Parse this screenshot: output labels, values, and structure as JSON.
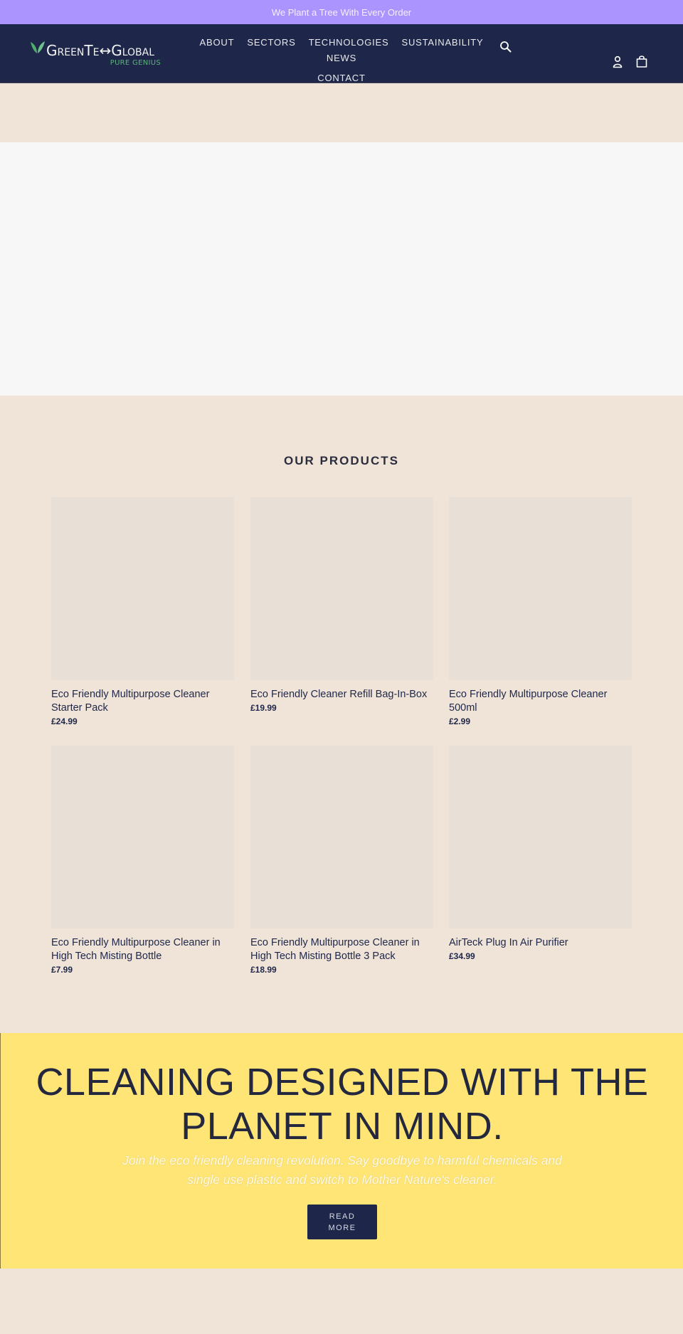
{
  "announcement": {
    "text": "We Plant a Tree With Every Order"
  },
  "header": {
    "logo": {
      "name": "GreenTechGlobal",
      "main_text": "GreenTe↔Global",
      "tagline": "PURE GENIUS"
    },
    "nav": [
      {
        "label": "ABOUT"
      },
      {
        "label": "SECTORS"
      },
      {
        "label": "TECHNOLOGIES"
      },
      {
        "label": "SUSTAINABILITY"
      },
      {
        "label": "NEWS"
      },
      {
        "label": "CONTACT"
      }
    ],
    "icons": {
      "search": "search-icon",
      "account": "account-icon",
      "cart": "cart-icon"
    }
  },
  "products": {
    "title": "OUR PRODUCTS",
    "items": [
      {
        "name": "Eco Friendly Multipurpose Cleaner Starter Pack",
        "price": "£24.99"
      },
      {
        "name": "Eco Friendly Cleaner Refill Bag-In-Box",
        "price": "£19.99"
      },
      {
        "name": "Eco Friendly Multipurpose Cleaner 500ml",
        "price": "£2.99"
      },
      {
        "name": "Eco Friendly Multipurpose Cleaner in High Tech Misting Bottle",
        "price": "£7.99"
      },
      {
        "name": "Eco Friendly Multipurpose Cleaner in High Tech Misting Bottle 3 Pack",
        "price": "£18.99"
      },
      {
        "name": "AirTeck Plug In Air Purifier",
        "price": "£34.99"
      }
    ]
  },
  "banner": {
    "heading": "CLEANING DESIGNED WITH THE PLANET IN MIND.",
    "subtext": "Join the eco friendly cleaning revolution. Say goodbye to harmful chemicals and single use plastic and switch to Mother Nature's cleaner.",
    "button_label": "READ MORE"
  },
  "colors": {
    "announcement_bg": "#ab94fe",
    "header_bg": "#1e2749",
    "page_bg": "#f0e4d9",
    "banner_bg": "#fee575",
    "accent_green": "#5bb37b"
  }
}
